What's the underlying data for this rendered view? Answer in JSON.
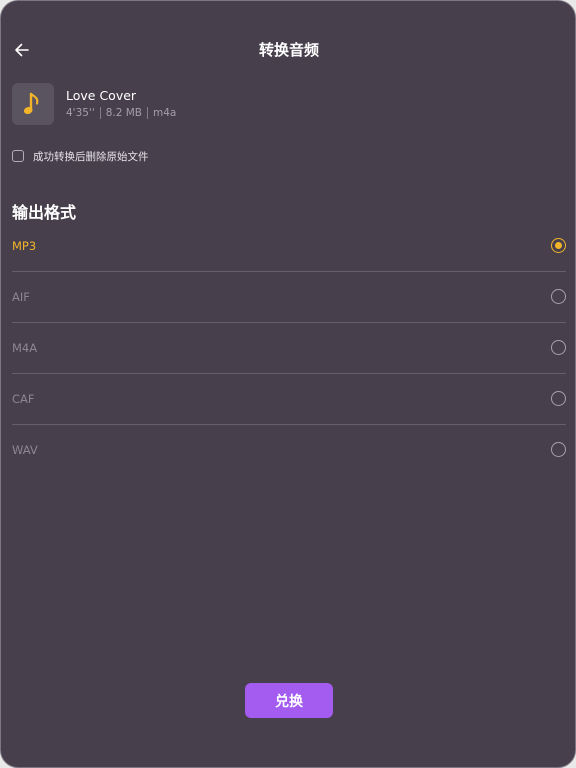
{
  "header": {
    "title": "转换音频",
    "back_icon": "arrow-left-icon"
  },
  "file": {
    "icon": "music-note-icon",
    "name": "Love Cover",
    "duration": "4'35''",
    "size": "8.2 MB",
    "format": "m4a"
  },
  "options": {
    "delete_original_label": "成功转换后删除原始文件",
    "delete_original_checked": false
  },
  "output": {
    "section_title": "输出格式",
    "selected": "MP3",
    "formats": [
      {
        "label": "MP3",
        "selected": true
      },
      {
        "label": "AIF",
        "selected": false
      },
      {
        "label": "M4A",
        "selected": false
      },
      {
        "label": "CAF",
        "selected": false
      },
      {
        "label": "WAV",
        "selected": false
      }
    ]
  },
  "actions": {
    "convert_label": "兑换"
  },
  "colors": {
    "background": "#473f4b",
    "accent": "#f2b52a",
    "button": "#a35bf0"
  }
}
